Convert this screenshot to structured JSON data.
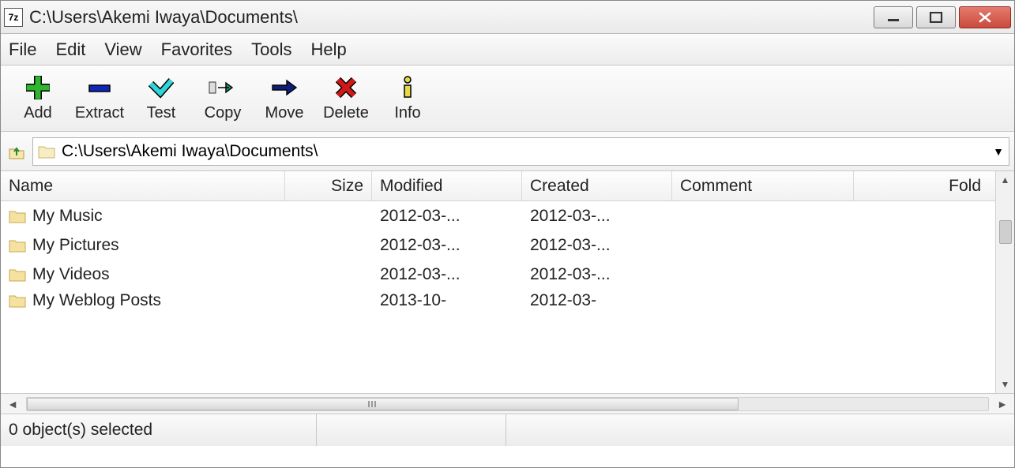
{
  "window": {
    "app_icon_text": "7z",
    "title": "C:\\Users\\Akemi Iwaya\\Documents\\"
  },
  "menu": {
    "items": [
      "File",
      "Edit",
      "View",
      "Favorites",
      "Tools",
      "Help"
    ]
  },
  "toolbar": {
    "buttons": [
      {
        "name": "add-button",
        "label": "Add",
        "icon": "plus",
        "color": "#2fb62f"
      },
      {
        "name": "extract-button",
        "label": "Extract",
        "icon": "minus",
        "color": "#1026b8"
      },
      {
        "name": "test-button",
        "label": "Test",
        "icon": "chevron-down",
        "color": "#2fd5d9"
      },
      {
        "name": "copy-button",
        "label": "Copy",
        "icon": "arrow-right-doc",
        "color": "#1f8f6e"
      },
      {
        "name": "move-button",
        "label": "Move",
        "icon": "arrow-right",
        "color": "#0e1f7a"
      },
      {
        "name": "delete-button",
        "label": "Delete",
        "icon": "x",
        "color": "#d01818"
      },
      {
        "name": "info-button",
        "label": "Info",
        "icon": "info",
        "color": "#d8c71a"
      }
    ]
  },
  "address": {
    "path": "C:\\Users\\Akemi Iwaya\\Documents\\"
  },
  "columns": {
    "name": "Name",
    "size": "Size",
    "modified": "Modified",
    "created": "Created",
    "comment": "Comment",
    "folders": "Fold"
  },
  "rows": [
    {
      "name": "My Music",
      "size": "",
      "modified": "2012-03-...",
      "created": "2012-03-...",
      "comment": ""
    },
    {
      "name": "My Pictures",
      "size": "",
      "modified": "2012-03-...",
      "created": "2012-03-...",
      "comment": ""
    },
    {
      "name": "My Videos",
      "size": "",
      "modified": "2012-03-...",
      "created": "2012-03-...",
      "comment": ""
    },
    {
      "name": "My Weblog Posts",
      "size": "",
      "modified": "2013-10-",
      "created": "2012-03-",
      "comment": ""
    }
  ],
  "status": {
    "selection": "0 object(s) selected"
  }
}
